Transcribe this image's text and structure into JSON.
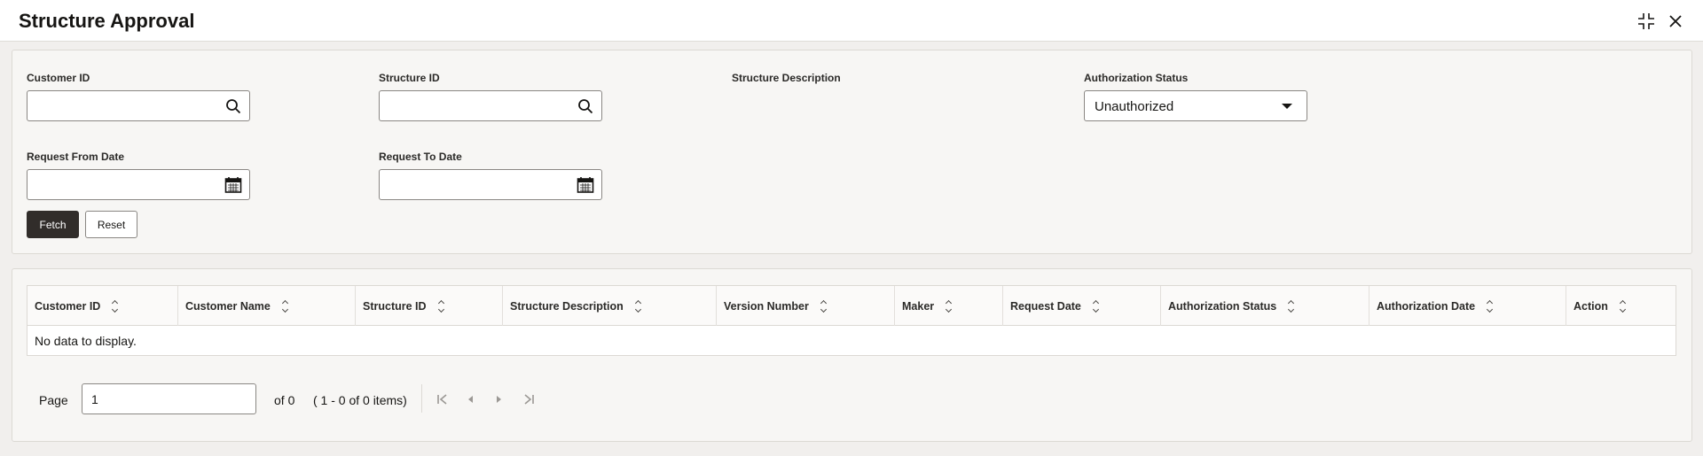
{
  "header": {
    "title": "Structure Approval"
  },
  "search": {
    "customer_id": {
      "label": "Customer ID",
      "value": ""
    },
    "structure_id": {
      "label": "Structure ID",
      "value": ""
    },
    "structure_description": {
      "label": "Structure Description"
    },
    "authorization_status": {
      "label": "Authorization Status",
      "selected": "Unauthorized"
    },
    "request_from_date": {
      "label": "Request From Date",
      "value": ""
    },
    "request_to_date": {
      "label": "Request To Date",
      "value": ""
    },
    "fetch_label": "Fetch",
    "reset_label": "Reset"
  },
  "table": {
    "columns": [
      "Customer ID",
      "Customer Name",
      "Structure ID",
      "Structure Description",
      "Version Number",
      "Maker",
      "Request Date",
      "Authorization Status",
      "Authorization Date",
      "Action"
    ],
    "empty_text": "No data to display."
  },
  "pagination": {
    "page_label": "Page",
    "page_value": "1",
    "of_text": "of 0",
    "range_text": "( 1 - 0 of 0 items)"
  },
  "icons": {
    "collapse": "collapse-icon",
    "close": "close-icon",
    "search": "search-icon",
    "calendar": "calendar-icon",
    "first": "first-page-icon",
    "prev": "previous-page-icon",
    "next": "next-page-icon",
    "last": "last-page-icon"
  },
  "colors": {
    "primary_button": "#312d2a",
    "background": "#f1efed",
    "panel": "#f7f6f4"
  }
}
